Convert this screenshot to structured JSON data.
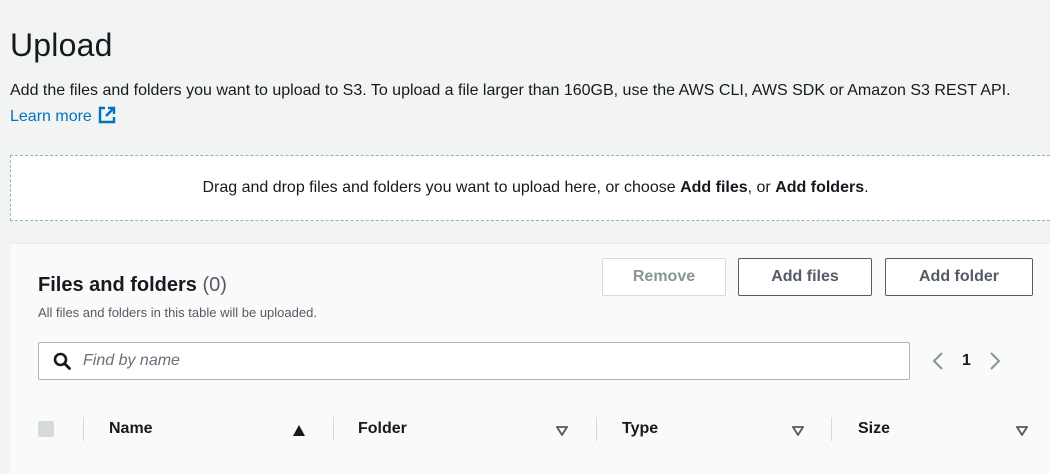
{
  "page": {
    "title": "Upload",
    "description": "Add the files and folders you want to upload to S3. To upload a file larger than 160GB, use the AWS CLI, AWS SDK or Amazon S3 REST API.",
    "learn_more": "Learn more"
  },
  "dropzone": {
    "text_before": "Drag and drop files and folders you want to upload here, or choose ",
    "add_files": "Add files",
    "text_mid": ", or ",
    "add_folders": "Add folders",
    "text_after": "."
  },
  "files_panel": {
    "title": "Files and folders",
    "count": "(0)",
    "subtitle": "All files and folders in this table will be uploaded.",
    "remove_label": "Remove",
    "add_files_label": "Add files",
    "add_folder_label": "Add folder",
    "search_placeholder": "Find by name",
    "current_page": "1",
    "columns": [
      "Name",
      "Folder",
      "Type",
      "Size"
    ]
  },
  "colors": {
    "link": "#0073bb",
    "background": "#f2f3f3",
    "disabled_text": "#879596"
  },
  "icons": {
    "learn_more": "external-link-icon",
    "search": "search-icon",
    "prev": "chevron-left-icon",
    "next": "chevron-right-icon",
    "sort_active": "sort-ascending-icon",
    "sort_inactive": "sort-caret-down-icon"
  }
}
